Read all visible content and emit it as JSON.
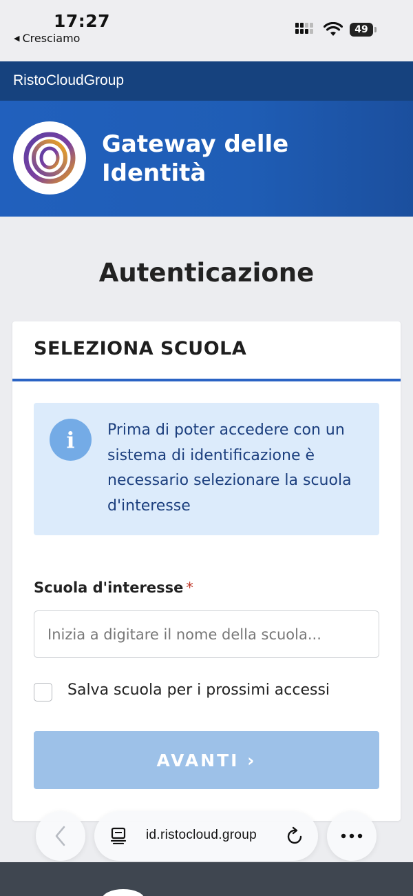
{
  "status_bar": {
    "time": "17:27",
    "back_app": "Cresciamo",
    "battery": "49"
  },
  "brand": {
    "name": "RistoCloudGroup"
  },
  "hero": {
    "title_line1": "Gateway delle",
    "title_line2": "Identità"
  },
  "page": {
    "title": "Autenticazione"
  },
  "card": {
    "header": "SELEZIONA SCUOLA",
    "info_icon": "i",
    "info_text": "Prima di poter accedere con un sistema di identificazione è necessario selezionare la scuola d'interesse",
    "field_label": "Scuola d'interesse",
    "required_mark": "*",
    "input_value": "",
    "input_placeholder": "Inizia a digitare il nome della scuola...",
    "checkbox_label": "Salva scuola per i prossimi accessi",
    "checkbox_checked": false,
    "next_button": "AVANTI ›"
  },
  "browser": {
    "url": "id.ristocloud.group"
  },
  "colors": {
    "brand_dark": "#16427e",
    "hero_blue": "#2160bd",
    "accent": "#2a63c4",
    "info_bg": "#dcebfb",
    "button_disabled": "#9dc1e8"
  },
  "icons": {
    "back_app": "back-triangle-icon",
    "signal": "cellular-signal-icon",
    "wifi": "wifi-icon",
    "battery": "battery-icon",
    "logo": "gateway-logo-icon",
    "info": "info-icon",
    "browser_back": "chevron-left-icon",
    "reader": "reader-mode-icon",
    "reload": "reload-icon",
    "more": "more-icon"
  }
}
